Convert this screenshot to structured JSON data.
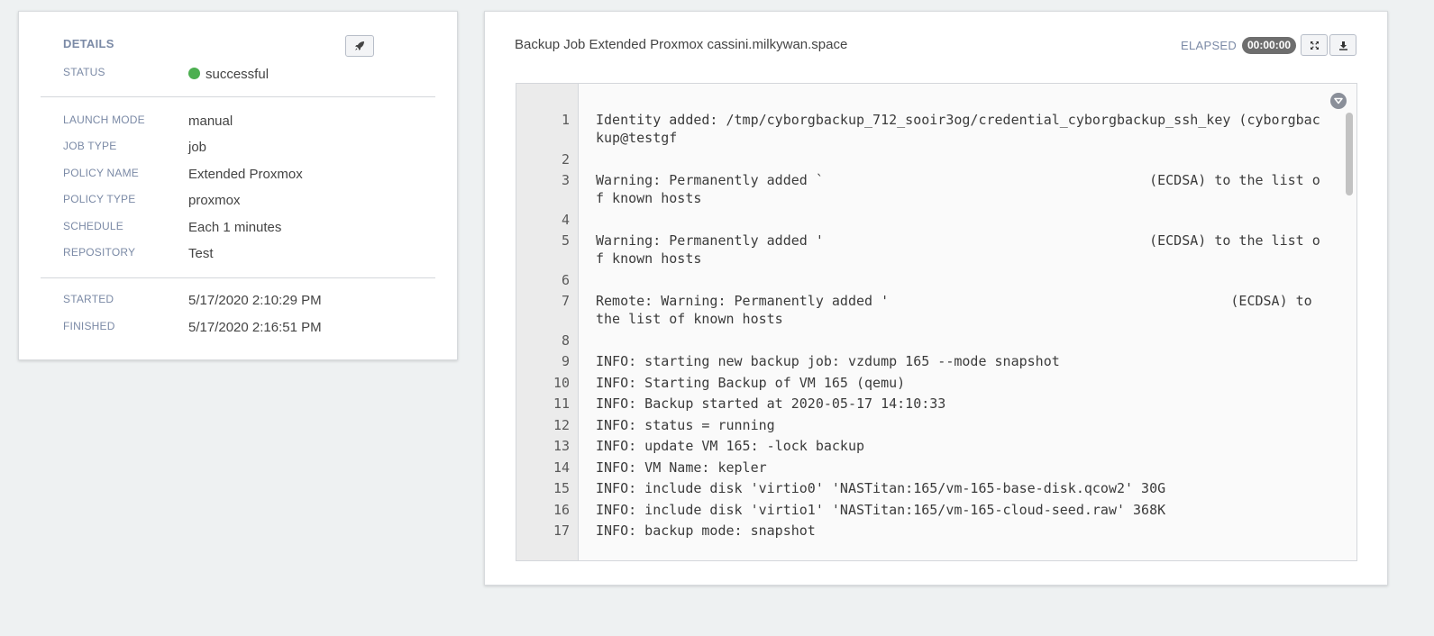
{
  "details": {
    "title": "DETAILS",
    "status": {
      "label": "STATUS",
      "value": "successful",
      "color": "#4caf50"
    },
    "info": [
      {
        "label": "LAUNCH MODE",
        "value": "manual"
      },
      {
        "label": "JOB TYPE",
        "value": "job"
      },
      {
        "label": "POLICY NAME",
        "value": "Extended Proxmox"
      },
      {
        "label": "POLICY TYPE",
        "value": "proxmox"
      },
      {
        "label": "SCHEDULE",
        "value": "Each 1 minutes"
      },
      {
        "label": "REPOSITORY",
        "value": "Test"
      }
    ],
    "times": [
      {
        "label": "STARTED",
        "value": "5/17/2020 2:10:29 PM"
      },
      {
        "label": "FINISHED",
        "value": "5/17/2020 2:16:51 PM"
      }
    ],
    "launch_icon": "rocket-icon"
  },
  "output": {
    "title": "Backup Job Extended Proxmox cassini.milkywan.space",
    "elapsed_label": "ELAPSED",
    "elapsed_value": "00:00:00",
    "expand_icon": "expand-icon",
    "download_icon": "download-icon",
    "collapse_icon": "collapse-icon",
    "lines": [
      {
        "n": "1",
        "text": "Identity added: /tmp/cyborgbackup_712_sooir3og/credential_cyborgbackup_ssh_key (cyborgbackup@testgf"
      },
      {
        "n": "2",
        "text": ""
      },
      {
        "n": "3",
        "text": "Warning: Permanently added `                                        (ECDSA) to the list of known hosts"
      },
      {
        "n": "4",
        "text": ""
      },
      {
        "n": "5",
        "text": "Warning: Permanently added '                                        (ECDSA) to the list of known hosts"
      },
      {
        "n": "6",
        "text": ""
      },
      {
        "n": "7",
        "text": "Remote: Warning: Permanently added '                                          (ECDSA) to the list of known hosts"
      },
      {
        "n": "8",
        "text": ""
      },
      {
        "n": "9",
        "text": "INFO: starting new backup job: vzdump 165 --mode snapshot"
      },
      {
        "n": "10",
        "text": "INFO: Starting Backup of VM 165 (qemu)"
      },
      {
        "n": "11",
        "text": "INFO: Backup started at 2020-05-17 14:10:33"
      },
      {
        "n": "12",
        "text": "INFO: status = running"
      },
      {
        "n": "13",
        "text": "INFO: update VM 165: -lock backup"
      },
      {
        "n": "14",
        "text": "INFO: VM Name: kepler"
      },
      {
        "n": "15",
        "text": "INFO: include disk 'virtio0' 'NASTitan:165/vm-165-base-disk.qcow2' 30G"
      },
      {
        "n": "16",
        "text": "INFO: include disk 'virtio1' 'NASTitan:165/vm-165-cloud-seed.raw' 368K"
      },
      {
        "n": "17",
        "text": "INFO: backup mode: snapshot"
      }
    ]
  }
}
